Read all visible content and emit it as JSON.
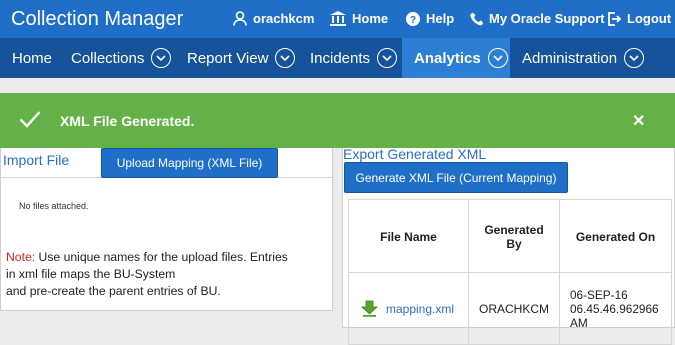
{
  "app": {
    "title": "Collection Manager"
  },
  "top_links": {
    "user": "orachkcm",
    "home": "Home",
    "help": "Help",
    "support": "My Oracle Support",
    "logout": "Logout"
  },
  "nav": {
    "home": "Home",
    "collections": "Collections",
    "report_view": "Report View",
    "incidents": "Incidents",
    "analytics": "Analytics",
    "administration": "Administration"
  },
  "banner": {
    "message": "XML File Generated."
  },
  "import": {
    "title": "Import File",
    "upload_button": "Upload Mapping (XML File)",
    "empty_text": "No files attached.",
    "note_label": "Note:",
    "note_line1": " Use unique names for the upload files. Entries",
    "note_line2": "in xml file maps the BU-System",
    "note_line3": "and pre-create the parent entries of BU."
  },
  "export": {
    "title": "Export Generated XML",
    "generate_button": "Generate XML File (Current Mapping)",
    "columns": [
      "File Name",
      "Generated By",
      "Generated On"
    ],
    "columns_split": {
      "generated_by_1": "Generated",
      "generated_by_2": "By"
    },
    "rows": [
      {
        "file_name": "mapping.xml",
        "generated_by": "ORACHKCM",
        "date_line1": "06-SEP-16",
        "date_line2": "06.45.46.962966",
        "date_line3": "AM"
      }
    ]
  },
  "colors": {
    "header": "#1f6fc8",
    "nav": "#16539a",
    "nav_active": "#2d7fd6",
    "banner": "#64b247",
    "note_label": "#e02020",
    "link": "#2a6fc0"
  }
}
